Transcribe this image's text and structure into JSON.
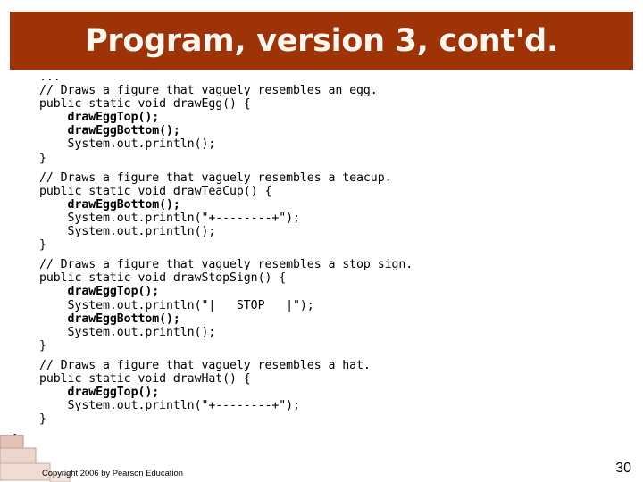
{
  "slide": {
    "title": "Program, version 3, cont'd.",
    "banner_color": "#9E3307",
    "title_color": "#FCF7EE",
    "background_color": "#FFFFFF"
  },
  "code": {
    "language": "java",
    "ellipsis": "...",
    "blocks": [
      {
        "id": "draw-egg",
        "lines": [
          {
            "text": "// Draws a figure that vaguely resembles an egg.",
            "bold": false
          },
          {
            "text": "public static void drawEgg() {",
            "bold": false
          },
          {
            "text": "    drawEggTop();",
            "bold": true
          },
          {
            "text": "    drawEggBottom();",
            "bold": true
          },
          {
            "text": "    System.out.println();",
            "bold": false
          },
          {
            "text": "}",
            "bold": false
          }
        ]
      },
      {
        "id": "draw-tea-cup",
        "lines": [
          {
            "text": "// Draws a figure that vaguely resembles a teacup.",
            "bold": false
          },
          {
            "text": "public static void drawTeaCup() {",
            "bold": false
          },
          {
            "text": "    drawEggBottom();",
            "bold": true
          },
          {
            "text": "    System.out.println(\"+--------+\");",
            "bold": false
          },
          {
            "text": "    System.out.println();",
            "bold": false
          },
          {
            "text": "}",
            "bold": false
          }
        ]
      },
      {
        "id": "draw-stop-sign",
        "lines": [
          {
            "text": "// Draws a figure that vaguely resembles a stop sign.",
            "bold": false
          },
          {
            "text": "public static void drawStopSign() {",
            "bold": false
          },
          {
            "text": "    drawEggTop();",
            "bold": true
          },
          {
            "text": "    System.out.println(\"|   STOP   |\");",
            "bold": false
          },
          {
            "text": "    drawEggBottom();",
            "bold": true
          },
          {
            "text": "    System.out.println();",
            "bold": false
          },
          {
            "text": "}",
            "bold": false
          }
        ]
      },
      {
        "id": "draw-hat",
        "lines": [
          {
            "text": "// Draws a figure that vaguely resembles a hat.",
            "bold": false
          },
          {
            "text": "public static void drawHat() {",
            "bold": false
          },
          {
            "text": "    drawEggTop();",
            "bold": true
          },
          {
            "text": "    System.out.println(\"+--------+\");",
            "bold": false
          },
          {
            "text": "}",
            "bold": false
          }
        ]
      }
    ],
    "outer_close_brace": "}"
  },
  "footer": {
    "copyright": "Copyright 2006 by Pearson Education",
    "page_number": "30"
  },
  "decoration": {
    "name": "stair-step-graphic",
    "fill_color": "#E8CFC6",
    "edge_color": "#C69A8C"
  }
}
